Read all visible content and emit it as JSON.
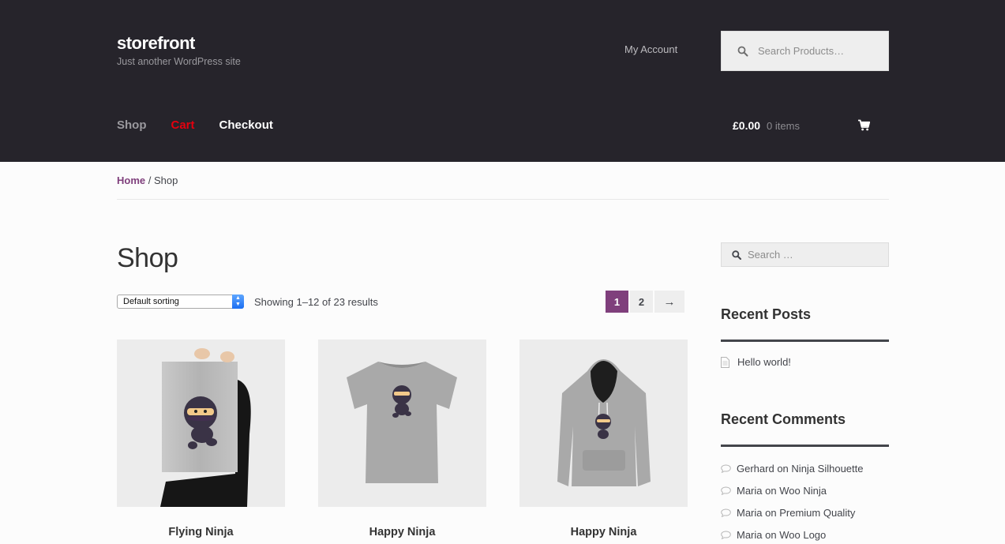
{
  "site": {
    "title": "storefront",
    "description": "Just another WordPress site"
  },
  "header": {
    "my_account": "My Account",
    "search_placeholder": "Search Products…"
  },
  "nav": {
    "items": [
      {
        "label": "Shop"
      },
      {
        "label": "Cart"
      },
      {
        "label": "Checkout"
      }
    ]
  },
  "mini_cart": {
    "amount": "£0.00",
    "count": "0 items"
  },
  "breadcrumb": {
    "home": "Home",
    "separator": "/",
    "current": "Shop"
  },
  "main": {
    "title": "Shop",
    "sorting_value": "Default sorting",
    "result_count": "Showing 1–12 of 23 results",
    "pagination": {
      "current": "1",
      "next_page": "2",
      "next_arrow": "→"
    },
    "products": [
      {
        "name": "Flying Ninja",
        "image": "poster"
      },
      {
        "name": "Happy Ninja",
        "image": "t-shirt"
      },
      {
        "name": "Happy Ninja",
        "image": "hoodie"
      }
    ]
  },
  "sidebar": {
    "search_placeholder": "Search …",
    "recent_posts_title": "Recent Posts",
    "recent_posts": [
      {
        "title": "Hello world!"
      }
    ],
    "recent_comments_title": "Recent Comments",
    "recent_comments": [
      {
        "author": "Gerhard",
        "on": "on",
        "post": "Ninja Silhouette"
      },
      {
        "author": "Maria",
        "on": "on",
        "post": "Woo Ninja"
      },
      {
        "author": "Maria",
        "on": "on",
        "post": "Premium Quality"
      },
      {
        "author": "Maria",
        "on": "on",
        "post": "Woo Logo"
      }
    ]
  },
  "colors": {
    "header_bg": "#26242b",
    "accent": "#7f3f7c",
    "cart_link": "#e4000e"
  }
}
